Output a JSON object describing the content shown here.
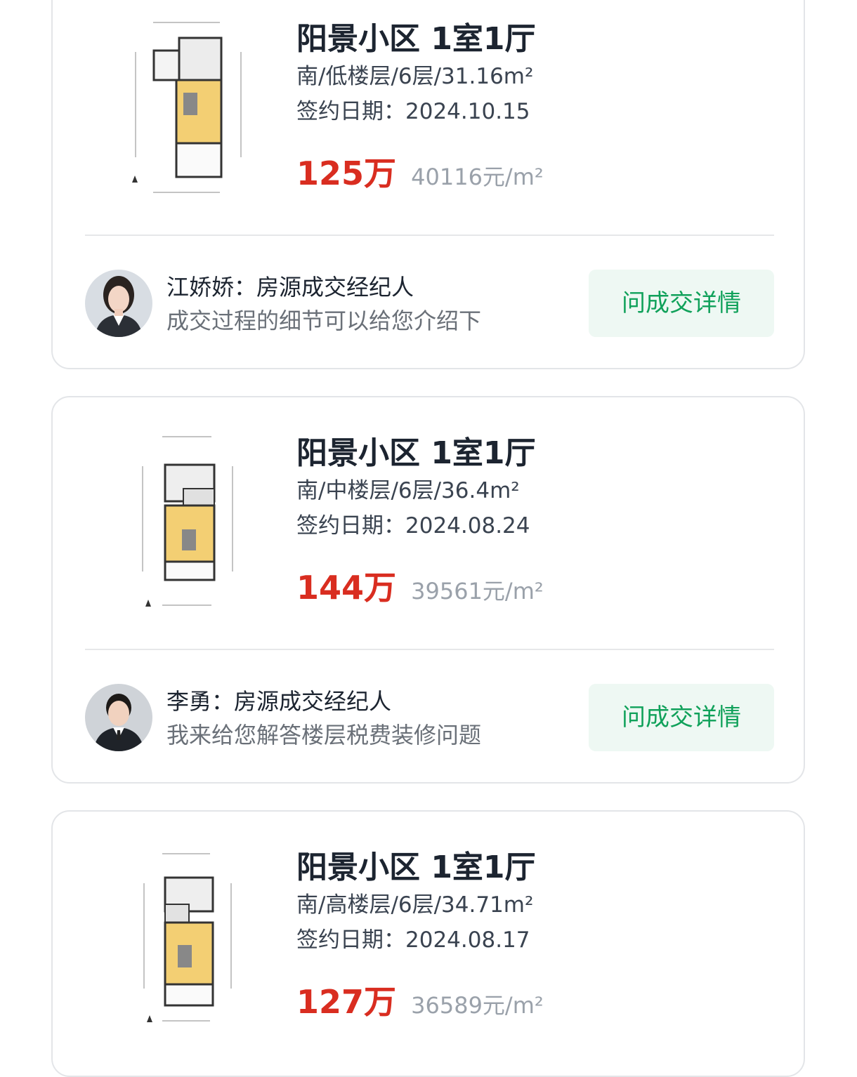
{
  "listings": [
    {
      "title": "阳景小区 1室1厅",
      "attrs": "南/低楼层/6层/31.16m²",
      "date": "签约日期：2024.10.15",
      "price": "125万",
      "unit_price": "40116元/m²",
      "agent": {
        "name": "江娇娇：房源成交经纪人",
        "message": "成交过程的细节可以给您介绍下",
        "button": "问成交详情"
      }
    },
    {
      "title": "阳景小区 1室1厅",
      "attrs": "南/中楼层/6层/36.4m²",
      "date": "签约日期：2024.08.24",
      "price": "144万",
      "unit_price": "39561元/m²",
      "agent": {
        "name": "李勇：房源成交经纪人",
        "message": "我来给您解答楼层税费装修问题",
        "button": "问成交详情"
      }
    },
    {
      "title": "阳景小区 1室1厅",
      "attrs": "南/高楼层/6层/34.71m²",
      "date": "签约日期：2024.08.17",
      "price": "127万",
      "unit_price": "36589元/m²"
    }
  ],
  "colors": {
    "price": "#d92d20",
    "button_text": "#10a15a",
    "button_bg": "#eef8f3"
  }
}
